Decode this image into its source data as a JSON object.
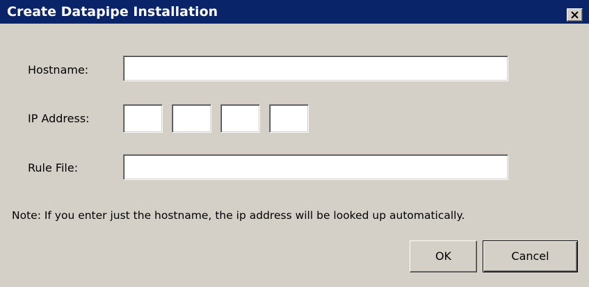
{
  "window": {
    "title": "Create Datapipe Installation",
    "close_icon": "close-icon"
  },
  "form": {
    "hostname_label": "Hostname:",
    "hostname_value": "",
    "ip_label": "IP Address:",
    "ip_octets": [
      "",
      "",
      "",
      ""
    ],
    "rule_file_label": "Rule File:",
    "rule_file_value": ""
  },
  "note": "Note: If you enter just the hostname, the ip address will be looked up automatically.",
  "buttons": {
    "ok_label": "OK",
    "cancel_label": "Cancel"
  },
  "colors": {
    "titlebar": "#0a246a",
    "dialog_face": "#d4d0c8"
  }
}
